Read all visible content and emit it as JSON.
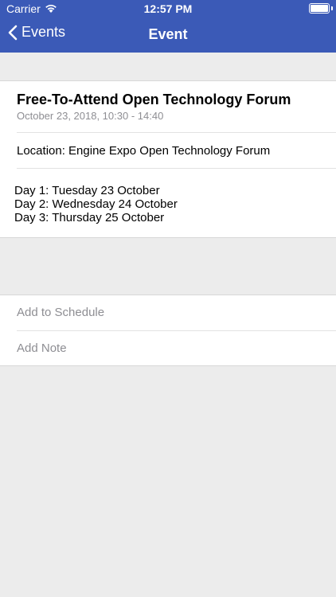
{
  "status_bar": {
    "carrier": "Carrier",
    "time": "12:57 PM"
  },
  "nav": {
    "back_label": "Events",
    "title": "Event"
  },
  "event": {
    "title": "Free-To-Attend Open Technology Forum",
    "date": "October 23, 2018, 10:30 - 14:40",
    "location": "Location: Engine Expo Open Technology Forum",
    "days": [
      "Day 1: Tuesday 23 October",
      "Day 2: Wednesday 24 October",
      "Day 3: Thursday 25 October"
    ]
  },
  "actions": {
    "add_schedule": "Add to Schedule",
    "add_note": "Add Note"
  },
  "colors": {
    "navbar": "#3b5ab7",
    "background": "#ececec",
    "secondary_text": "#8e8e93"
  }
}
